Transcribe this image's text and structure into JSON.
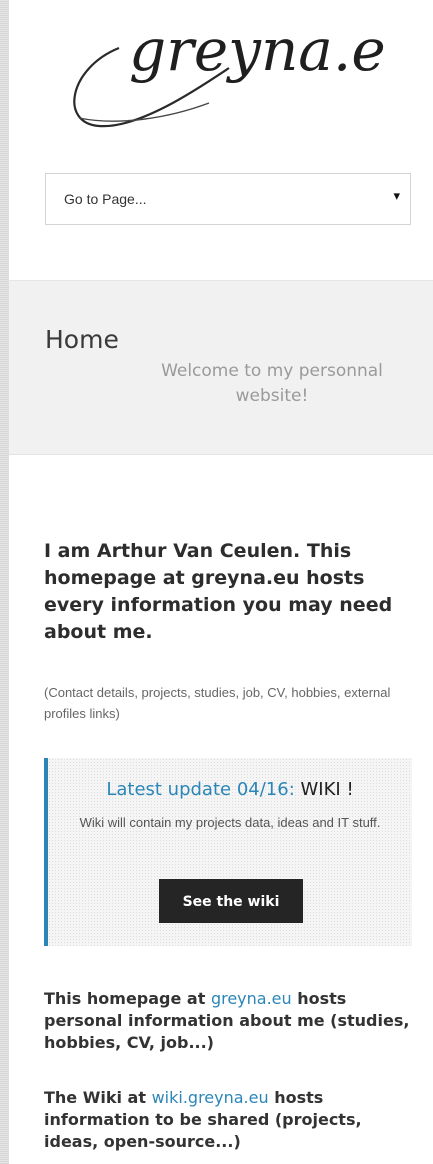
{
  "header": {
    "logo_text": "greyna.eu",
    "nav_select_value": "Go to Page...",
    "nav_select_arrow": "▾"
  },
  "home": {
    "title": "Home",
    "subtitle": "Welcome to my personnal website!"
  },
  "main": {
    "intro": "I am Arthur Van Ceulen. This homepage at greyna.eu hosts every information you may need about me.",
    "intro_sub": "(Contact details, projects, studies, job, CV, hobbies, external profiles links)",
    "callout": {
      "prefix": "Latest update 04/16:",
      "highlight": "WIKI !",
      "text": "Wiki will contain my projects data, ideas and IT stuff.",
      "button_label": "See the wiki"
    },
    "para1": {
      "before": "This homepage at ",
      "link": "greyna.eu",
      "after": " hosts personal information about me (studies, hobbies, CV, job...)"
    },
    "para2": {
      "before": "The Wiki at ",
      "link": "wiki.greyna.eu",
      "after": " hosts information to be shared (projects, ideas, open-source...)"
    }
  },
  "colors": {
    "accent": "#2b86b7",
    "button_bg": "#252525",
    "band_bg": "#f1f1f1"
  }
}
